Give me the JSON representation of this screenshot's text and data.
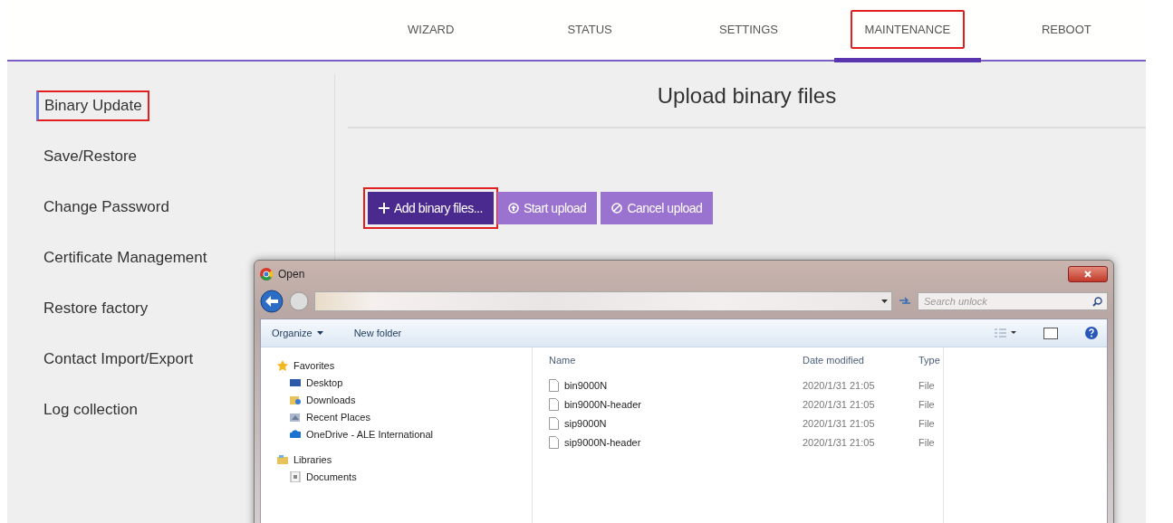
{
  "nav": {
    "tabs": [
      {
        "label": "WIZARD",
        "selected": false,
        "highlighted": false
      },
      {
        "label": "STATUS",
        "selected": false,
        "highlighted": false
      },
      {
        "label": "SETTINGS",
        "selected": false,
        "highlighted": false
      },
      {
        "label": "MAINTENANCE",
        "selected": true,
        "highlighted": true
      },
      {
        "label": "REBOOT",
        "selected": false,
        "highlighted": false
      }
    ]
  },
  "sidebar": {
    "items": [
      {
        "label": "Binary Update",
        "selected": true,
        "highlighted": true
      },
      {
        "label": "Save/Restore",
        "selected": false,
        "highlighted": false
      },
      {
        "label": "Change Password",
        "selected": false,
        "highlighted": false
      },
      {
        "label": "Certificate Management",
        "selected": false,
        "highlighted": false
      },
      {
        "label": "Restore factory",
        "selected": false,
        "highlighted": false
      },
      {
        "label": "Contact Import/Export",
        "selected": false,
        "highlighted": false
      },
      {
        "label": "Log collection",
        "selected": false,
        "highlighted": false
      }
    ]
  },
  "content": {
    "title": "Upload binary files",
    "buttons": [
      {
        "kind": "add",
        "label": "Add binary files...",
        "highlighted": true
      },
      {
        "kind": "start",
        "label": "Start upload",
        "highlighted": false
      },
      {
        "kind": "cancel",
        "label": "Cancel upload",
        "highlighted": false
      }
    ]
  },
  "dialog": {
    "title": "Open",
    "search": {
      "placeholder": "Search unlock"
    },
    "toolbar": {
      "organize": "Organize",
      "new_folder": "New folder"
    },
    "nav_pane": [
      {
        "label": "Favorites",
        "kind": "star",
        "children": [
          {
            "label": "Desktop",
            "kind": "desktop"
          },
          {
            "label": "Downloads",
            "kind": "downloads"
          },
          {
            "label": "Recent Places",
            "kind": "recent"
          },
          {
            "label": "OneDrive - ALE International",
            "kind": "cloud"
          }
        ]
      },
      {
        "label": "Libraries",
        "kind": "library",
        "children": [
          {
            "label": "Documents",
            "kind": "document"
          }
        ]
      }
    ],
    "columns": [
      "Name",
      "Date modified",
      "Type"
    ],
    "files": [
      {
        "name": "bin9000N",
        "date": "2020/1/31 21:05",
        "type": "File"
      },
      {
        "name": "bin9000N-header",
        "date": "2020/1/31 21:05",
        "type": "File"
      },
      {
        "name": "sip9000N",
        "date": "2020/1/31 21:05",
        "type": "File"
      },
      {
        "name": "sip9000N-header",
        "date": "2020/1/31 21:05",
        "type": "File"
      }
    ]
  }
}
